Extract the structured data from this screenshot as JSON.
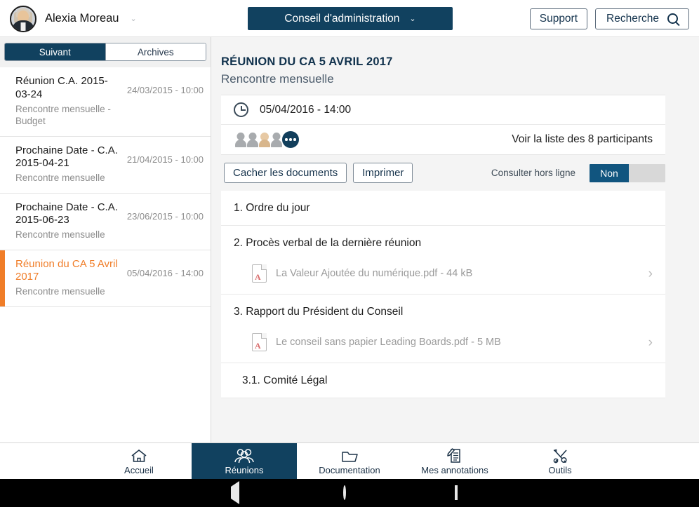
{
  "topbar": {
    "user_name": "Alexia Moreau",
    "user_caret": "⌄",
    "avatar_name": "user-avatar",
    "org_label": "Conseil d'administration",
    "org_caret": "⌄",
    "support_label": "Support",
    "search_label": "Recherche"
  },
  "sidebar": {
    "tabs": [
      {
        "label": "Suivant",
        "active": true
      },
      {
        "label": "Archives",
        "active": false
      }
    ],
    "meetings": [
      {
        "title": "Réunion C.A. 2015-03-24",
        "subtitle": "Rencontre mensuelle - Budget",
        "date": "24/03/2015 - 10:00",
        "selected": false
      },
      {
        "title": "Prochaine Date - C.A. 2015-04-21",
        "subtitle": "Rencontre mensuelle",
        "date": "21/04/2015 - 10:00",
        "selected": false
      },
      {
        "title": "Prochaine Date - C.A. 2015-06-23",
        "subtitle": "Rencontre mensuelle",
        "date": "23/06/2015 - 10:00",
        "selected": false
      },
      {
        "title": "Réunion du CA 5 Avril 2017",
        "subtitle": "Rencontre mensuelle",
        "date": "05/04/2016 - 14:00",
        "selected": true
      }
    ]
  },
  "meeting": {
    "title": "RÉUNION DU CA 5 AVRIL 2017",
    "subtitle": "Rencontre mensuelle",
    "datetime": "05/04/2016 - 14:00",
    "participants_link": "Voir la liste des 8 participants",
    "participants_count": 8,
    "toolbar": {
      "hide_documents_label": "Cacher les documents",
      "print_label": "Imprimer",
      "offline_label": "Consulter hors ligne",
      "offline_value": "Non"
    },
    "agenda": [
      {
        "heading": "1. Ordre du jour",
        "sub": false,
        "file": null
      },
      {
        "heading": "2. Procès verbal de la dernière réunion",
        "sub": false,
        "file": {
          "name": "La Valeur Ajoutée du numérique.pdf",
          "size": "44 kB"
        }
      },
      {
        "heading": "3. Rapport du Président du Conseil",
        "sub": false,
        "file": {
          "name": "Le conseil sans papier Leading Boards.pdf",
          "size": "5 MB"
        }
      },
      {
        "heading": "3.1. Comité Légal",
        "sub": true,
        "file": null
      }
    ]
  },
  "bottom_nav": [
    {
      "label": "Accueil",
      "icon": "home-icon",
      "active": false
    },
    {
      "label": "Réunions",
      "icon": "people-icon",
      "active": true
    },
    {
      "label": "Documentation",
      "icon": "folder-icon",
      "active": false
    },
    {
      "label": "Mes annotations",
      "icon": "annotated-document-icon",
      "active": false
    },
    {
      "label": "Outils",
      "icon": "tools-icon",
      "active": false
    }
  ],
  "android_nav": {
    "back": "back-triangle",
    "home": "home-circle",
    "recents": "recents-square"
  },
  "colors": {
    "navy": "#11415f",
    "orange": "#f07d28",
    "toggle_on": "#11557f",
    "muted": "#8d8d8d"
  }
}
